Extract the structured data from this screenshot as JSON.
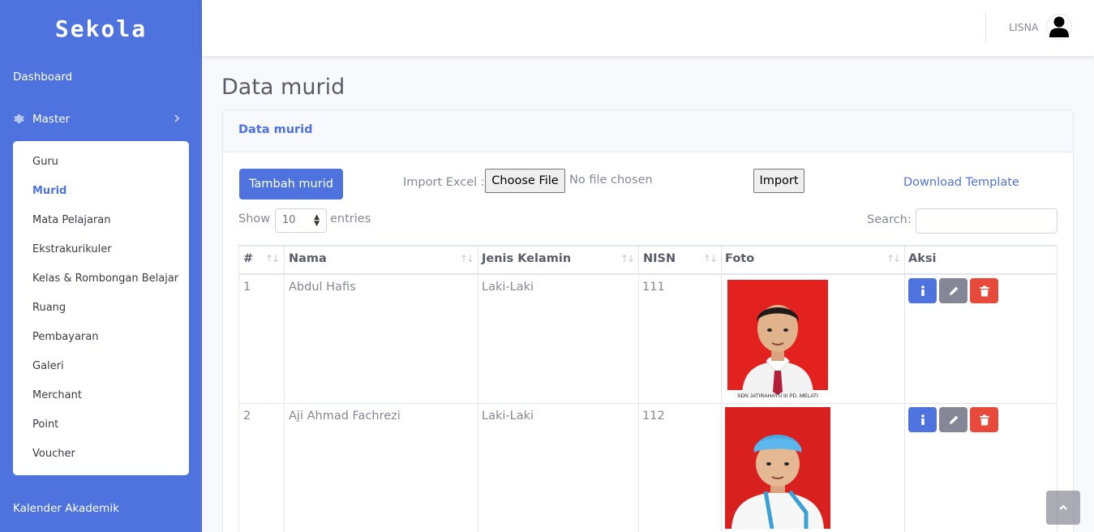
{
  "brand": {
    "name": "Sekola"
  },
  "sidebar": {
    "dashboard": "Dashboard",
    "master": "Master",
    "submenu": [
      "Guru",
      "Murid",
      "Mata Pelajaran",
      "Ekstrakurikuler",
      "Kelas & Rombongan Belajar",
      "Ruang",
      "Pembayaran",
      "Galeri",
      "Merchant",
      "Point",
      "Voucher"
    ],
    "active_item": "Murid",
    "kalender": "Kalender Akademik"
  },
  "topbar": {
    "user": "LISNA"
  },
  "page": {
    "title": "Data murid"
  },
  "card": {
    "header": "Data murid"
  },
  "toolbar": {
    "add_button": "Tambah murid",
    "import_label": "Import Excel :",
    "choose_file": "Choose File",
    "file_status": "No file chosen",
    "import_button": "Import",
    "download_template": "Download Template"
  },
  "datatable": {
    "show_label": "Show",
    "entries_value": "10",
    "entries_label": "entries",
    "search_label": "Search:",
    "search_value": ""
  },
  "table": {
    "headers": [
      "#",
      "Nama",
      "Jenis Kelamin",
      "NISN",
      "Foto",
      "Aksi"
    ],
    "rows": [
      {
        "no": "1",
        "nama": "Abdul Hafis",
        "jenis_kelamin": "Laki-Laki",
        "nisn": "111",
        "photo_caption": "SDN JATIRAHAYU III PD. MELATI"
      },
      {
        "no": "2",
        "nama": "Aji Ahmad Fachrezi",
        "jenis_kelamin": "Laki-Laki",
        "nisn": "112",
        "photo_caption": ""
      }
    ]
  },
  "colors": {
    "primary": "#4e73df",
    "secondary": "#858796",
    "danger": "#e74a3b",
    "photo_bg": "#e3211f"
  },
  "icons": {
    "info": "info-icon",
    "edit": "pencil-icon",
    "delete": "trash-icon",
    "scroll_top": "chevron-up-icon",
    "user": "user-icon",
    "settings": "gear-icon"
  }
}
